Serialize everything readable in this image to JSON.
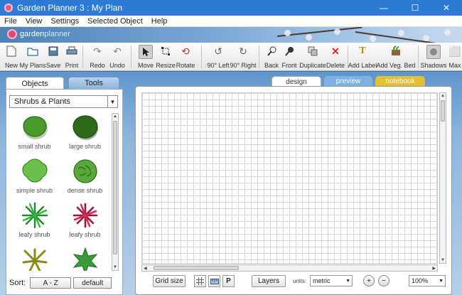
{
  "window": {
    "title": "Garden Planner 3 : My  Plan",
    "minimize": "—",
    "maximize": "☐",
    "close": "✕"
  },
  "menu": [
    "File",
    "View",
    "Settings",
    "Selected Object",
    "Help"
  ],
  "brand": {
    "part1": "garden",
    "part2": "planner"
  },
  "toolbar": {
    "new": "New",
    "my_plans": "My Plans",
    "save": "Save",
    "print": "Print",
    "redo": "Redo",
    "undo": "Undo",
    "move": "Move",
    "resize": "Resize",
    "rotate": "Rotate",
    "rot_left": "90° Left",
    "rot_right": "90° Right",
    "back": "Back",
    "front": "Front",
    "duplicate": "Duplicate",
    "delete": "Delete",
    "add_label": "Add Label",
    "add_veg_bed": "Add Veg. Bed",
    "shadows": "Shadows",
    "max": "Max"
  },
  "left": {
    "tab_objects": "Objects",
    "tab_tools": "Tools",
    "category": "Shrubs & Plants",
    "plants": [
      {
        "name": "small shrub",
        "icon": "small-shrub"
      },
      {
        "name": "large shrub",
        "icon": "large-shrub"
      },
      {
        "name": "simple shrub",
        "icon": "simple-shrub"
      },
      {
        "name": "dense shrub",
        "icon": "dense-shrub"
      },
      {
        "name": "leafy shrub",
        "icon": "leafy-shrub-green"
      },
      {
        "name": "leafy shrub",
        "icon": "leafy-shrub-red"
      },
      {
        "name": "",
        "icon": "spiky-plant"
      },
      {
        "name": "",
        "icon": "star-plant"
      }
    ],
    "sort_label": "Sort:",
    "sort_az": "A - Z",
    "sort_default": "default"
  },
  "view_tabs": {
    "design": "design",
    "preview": "preview",
    "notebook": "notebook"
  },
  "bottom": {
    "grid_size": "Grid size",
    "p_button": "P",
    "layers": "Layers",
    "units_label": "units:",
    "units_value": "metric",
    "zoom_value": "100%"
  },
  "colors": {
    "accent": "#2d7bd5",
    "preview_tab": "#7fb2e2",
    "notebook_tab": "#e2c035"
  }
}
